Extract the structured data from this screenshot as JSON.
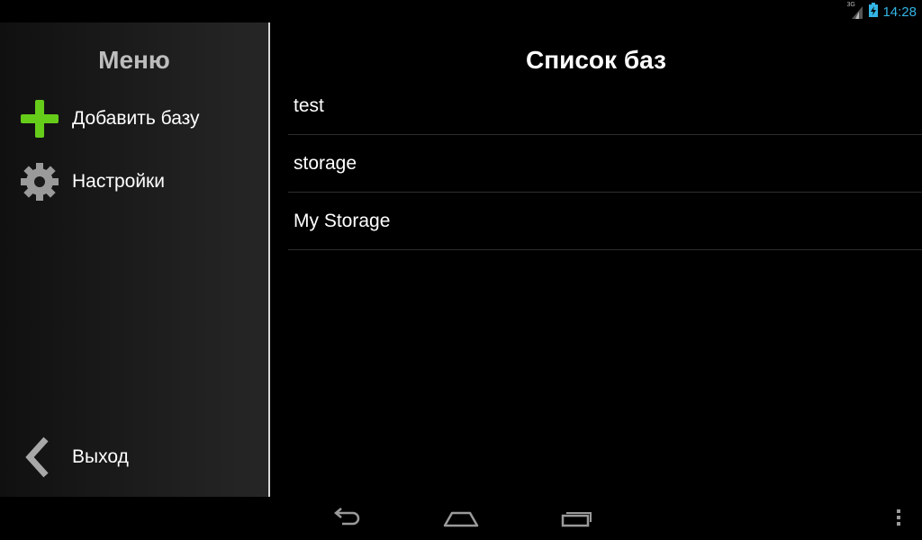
{
  "status": {
    "network_type": "3G",
    "time": "14:28"
  },
  "sidebar": {
    "title": "Меню",
    "items": [
      {
        "label": "Добавить базу",
        "icon": "plus-icon"
      },
      {
        "label": "Настройки",
        "icon": "gear-icon"
      }
    ],
    "exit": {
      "label": "Выход",
      "icon": "back-chevron-icon"
    }
  },
  "main": {
    "title": "Список баз",
    "databases": [
      "test",
      "storage",
      "My Storage"
    ]
  },
  "navbar": {
    "buttons": [
      "back-icon",
      "home-icon",
      "recents-icon",
      "overflow-menu-icon"
    ]
  },
  "colors": {
    "accent": "#33b5e5",
    "plus": "#66cc1a",
    "divider": "#d8d8d8"
  }
}
